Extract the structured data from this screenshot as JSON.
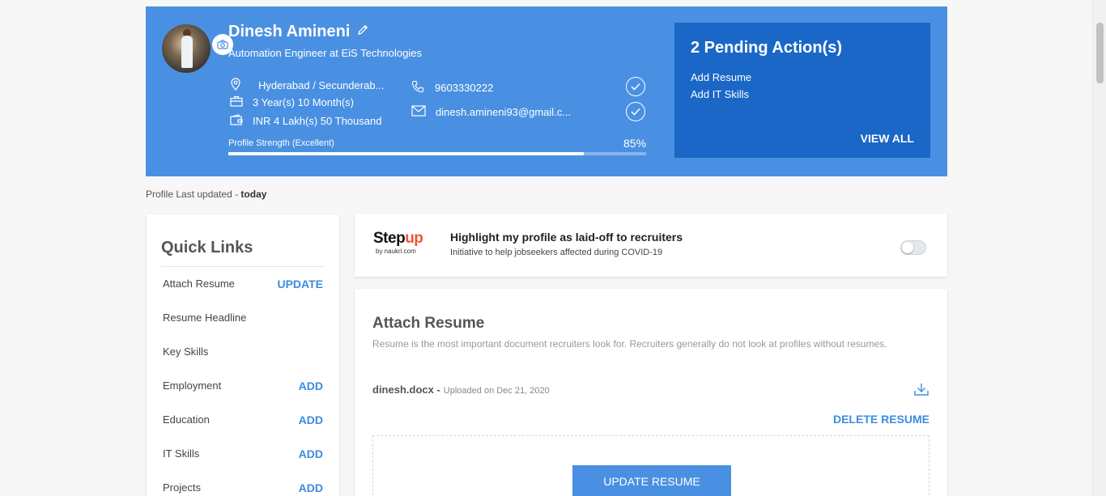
{
  "profile": {
    "name": "Dinesh Amineni",
    "title": "Automation Engineer at EiS Technologies",
    "location": "Hyderabad / Secunderab...",
    "experience": "3 Year(s) 10 Month(s)",
    "salary": "INR 4 Lakh(s) 50 Thousand",
    "phone": "9603330222",
    "email": "dinesh.amineni93@gmail.c...",
    "strength_label": "Profile Strength (Excellent)",
    "strength_pct": "85%",
    "strength_value": 0.85
  },
  "pending": {
    "title": "2 Pending Action(s)",
    "actions": [
      "Add Resume",
      "Add IT Skills"
    ],
    "view_all": "VIEW ALL"
  },
  "updated": {
    "prefix": "Profile Last updated - ",
    "value": "today"
  },
  "quick_links": {
    "title": "Quick Links",
    "items": [
      {
        "label": "Attach Resume",
        "action": "UPDATE"
      },
      {
        "label": "Resume Headline",
        "action": ""
      },
      {
        "label": "Key Skills",
        "action": ""
      },
      {
        "label": "Employment",
        "action": "ADD"
      },
      {
        "label": "Education",
        "action": "ADD"
      },
      {
        "label": "IT Skills",
        "action": "ADD"
      },
      {
        "label": "Projects",
        "action": "ADD"
      }
    ]
  },
  "stepup": {
    "logo_step": "Step",
    "logo_up": "up",
    "logo_by": "by naukri.com",
    "heading": "Highlight my profile as laid-off to recruiters",
    "sub": "Initiative to help jobseekers affected during COVID-19",
    "toggle_on": false
  },
  "resume": {
    "title": "Attach Resume",
    "desc": "Resume is the most important document recruiters look for. Recruiters generally do not look at profiles without resumes.",
    "file_name": "dinesh.docx -",
    "uploaded": "Uploaded on Dec 21, 2020",
    "delete": "DELETE RESUME",
    "update": "UPDATE RESUME"
  },
  "colors": {
    "hero": "#4a90e2",
    "pending": "#1a67c7",
    "link": "#3b8de0",
    "stepup_orange": "#f05537"
  }
}
